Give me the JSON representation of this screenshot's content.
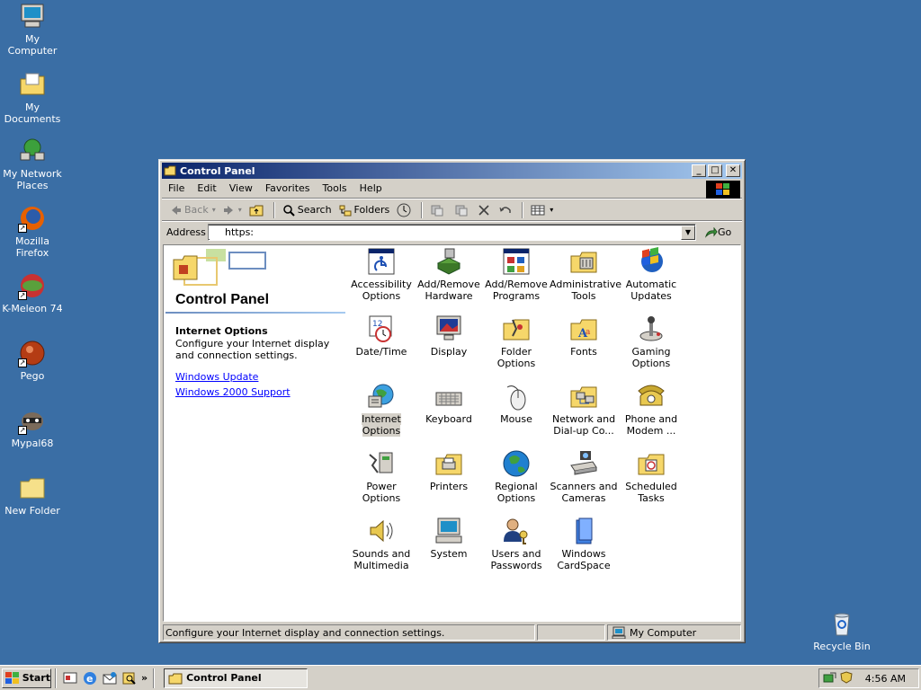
{
  "desktop": {
    "icons": [
      {
        "label": "My Computer"
      },
      {
        "label": "My Documents"
      },
      {
        "label": "My Network Places"
      },
      {
        "label": "Mozilla Firefox"
      },
      {
        "label": "K-Meleon 74"
      },
      {
        "label": "Pego"
      },
      {
        "label": "Mypal68"
      },
      {
        "label": "New Folder"
      },
      {
        "label": "Recycle Bin"
      }
    ]
  },
  "window": {
    "title": "Control Panel",
    "menu": [
      "File",
      "Edit",
      "View",
      "Favorites",
      "Tools",
      "Help"
    ],
    "toolbar": {
      "back": "Back",
      "search": "Search",
      "folders": "Folders"
    },
    "address": {
      "label": "Address",
      "value": "https:",
      "go": "Go"
    },
    "left_pane": {
      "title": "Control Panel",
      "selected_name": "Internet Options",
      "selected_desc": "Configure your Internet display and connection settings.",
      "links": [
        "Windows Update",
        "Windows 2000 Support"
      ]
    },
    "items": [
      {
        "label": "Accessibility Options"
      },
      {
        "label": "Add/Remove Hardware"
      },
      {
        "label": "Add/Remove Programs"
      },
      {
        "label": "Administrative Tools"
      },
      {
        "label": "Automatic Updates"
      },
      {
        "label": "Date/Time"
      },
      {
        "label": "Display"
      },
      {
        "label": "Folder Options"
      },
      {
        "label": "Fonts"
      },
      {
        "label": "Gaming Options"
      },
      {
        "label": "Internet Options"
      },
      {
        "label": "Keyboard"
      },
      {
        "label": "Mouse"
      },
      {
        "label": "Network and Dial-up Co..."
      },
      {
        "label": "Phone and Modem ..."
      },
      {
        "label": "Power Options"
      },
      {
        "label": "Printers"
      },
      {
        "label": "Regional Options"
      },
      {
        "label": "Scanners and Cameras"
      },
      {
        "label": "Scheduled Tasks"
      },
      {
        "label": "Sounds and Multimedia"
      },
      {
        "label": "System"
      },
      {
        "label": "Users and Passwords"
      },
      {
        "label": "Windows CardSpace"
      }
    ],
    "status": {
      "text": "Configure your Internet display and connection settings.",
      "zone": "My Computer"
    }
  },
  "taskbar": {
    "start": "Start",
    "task": "Control Panel",
    "clock": "4:56 AM"
  }
}
